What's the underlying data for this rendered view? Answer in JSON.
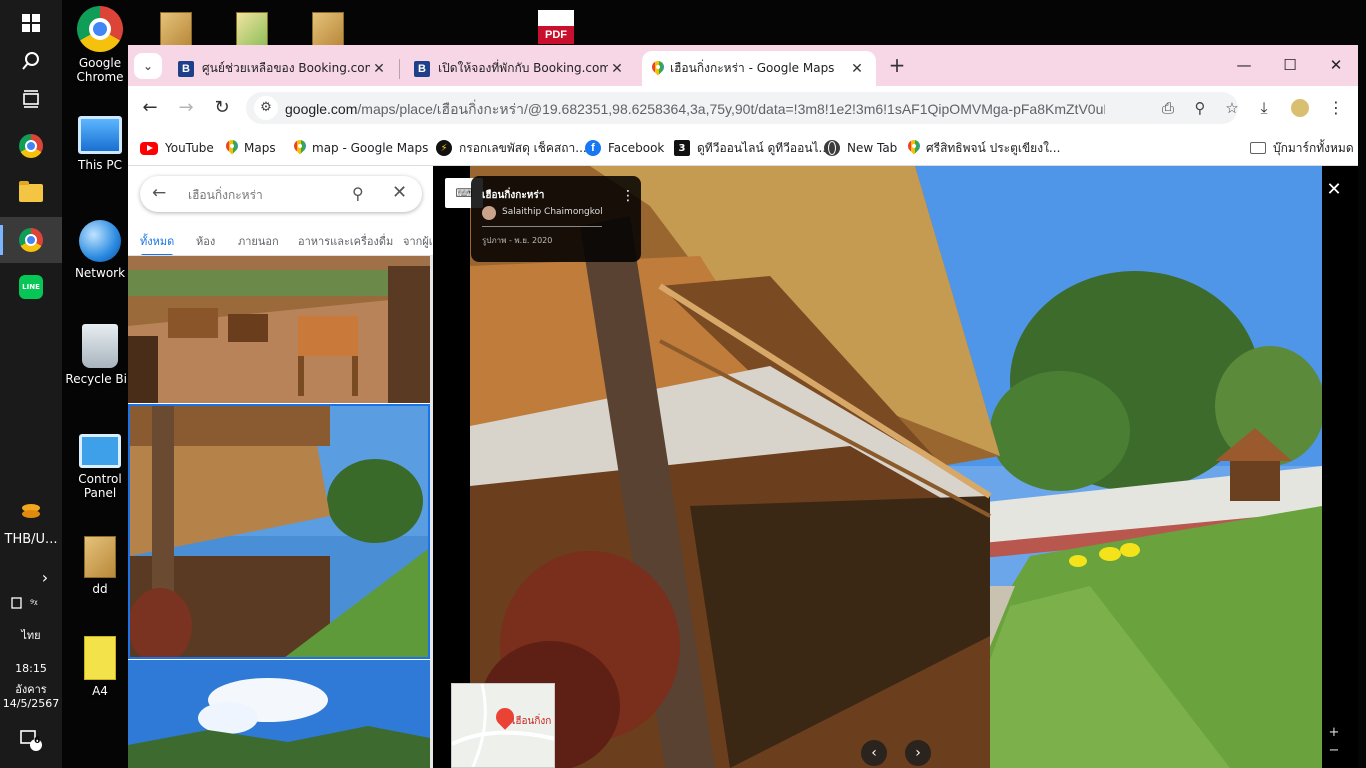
{
  "taskbar": {
    "clock_time": "18:15",
    "clock_day": "อังคาร",
    "clock_date": "14/5/2567",
    "language": "ไทย",
    "currency_widget": "THB/U...",
    "notification_count": "6"
  },
  "desktop": {
    "icons": [
      {
        "label": "Google Chrome"
      },
      {
        "label": "This PC"
      },
      {
        "label": "Network"
      },
      {
        "label": "Recycle Bin"
      },
      {
        "label": "Control Panel"
      },
      {
        "label": "dd"
      },
      {
        "label": "A4"
      }
    ],
    "pdf_label": "PDF"
  },
  "browser": {
    "tabs": [
      {
        "title": "ศูนย์ช่วยเหลือของ Booking.com",
        "favicon": "B",
        "active": false
      },
      {
        "title": "เปิดให้จองที่พักกับ Booking.com",
        "favicon": "B",
        "active": false
      },
      {
        "title": "เฮือนกิ่งกะหร่า - Google Maps",
        "favicon": "maps-pin",
        "active": true
      }
    ],
    "url_host": "google.com",
    "url_path": "/maps/place/เฮือนกิ่งกะหร่า/@19.682351,98.6258364,3a,75y,90t/data=!3m8!1e2!3m6!1sAF1QipOMVMga-pFa8KmZtV0uPK4gC...",
    "bookmarks": [
      {
        "label": "YouTube",
        "icon": "youtube-icon"
      },
      {
        "label": "Maps",
        "icon": "maps-pin-icon"
      },
      {
        "label": "map - Google Maps",
        "icon": "maps-pin-icon"
      },
      {
        "label": "กรอกเลขพัสดุ เช็คสถา...",
        "icon": "bolt-icon"
      },
      {
        "label": "Facebook",
        "icon": "facebook-icon"
      },
      {
        "label": "ดูทีวีออนไลน์ ดูทีวีออนไ...",
        "icon": "channel3-icon"
      },
      {
        "label": "New Tab",
        "icon": "globe-icon"
      },
      {
        "label": "ศรีสิทธิพจน์ ประตูเขียงใ...",
        "icon": "maps-pin-icon"
      }
    ],
    "all_bookmarks": "บุ๊กมาร์กทั้งหมด"
  },
  "maps": {
    "search_value": "เฮือนกิ่งกะหร่า",
    "filter_tabs": [
      "ทั้งหมด",
      "ห้อง",
      "ภายนอก",
      "อาหารและเครื่องดื่ม",
      "จากผู้เ"
    ],
    "photo": {
      "place_name": "เฮือนกิ่งกะหร่า",
      "author": "Salaithip Chaimongkol",
      "date": "รูปภาพ - พ.ย. 2020"
    },
    "minimap_label": "เฮือนกิ่งก"
  },
  "colors": {
    "tabbar_bg": "#f7d6e6",
    "accent_blue": "#1a73e8",
    "taskbar_bg": "#1a1a1a"
  }
}
